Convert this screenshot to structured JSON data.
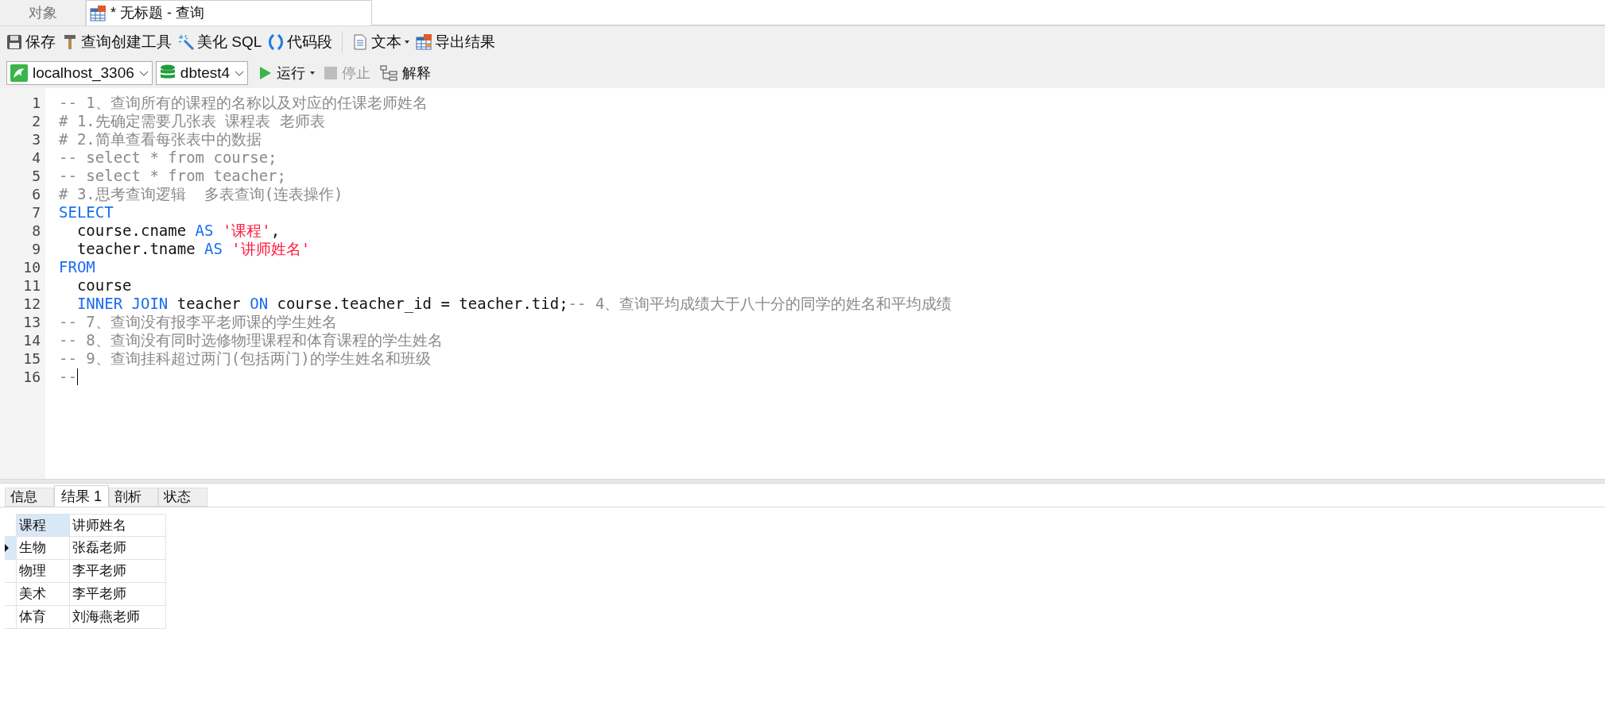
{
  "tabs": [
    {
      "label": "对象",
      "selected": false,
      "icon": false
    },
    {
      "label": "* 无标题 - 查询",
      "selected": true,
      "icon": true
    }
  ],
  "toolbar": [
    {
      "kind": "save",
      "label": "保存"
    },
    {
      "kind": "builder",
      "label": "查询创建工具"
    },
    {
      "kind": "beautify",
      "label": "美化 SQL"
    },
    {
      "kind": "snippet",
      "label": "代码段"
    },
    {
      "kind": "separator"
    },
    {
      "kind": "text",
      "label": "文本",
      "dropdown": true
    },
    {
      "kind": "export",
      "label": "导出结果"
    }
  ],
  "connection": {
    "value": "localhost_3306"
  },
  "database": {
    "value": "dbtest4"
  },
  "actions": [
    {
      "kind": "run",
      "label": "运行",
      "dropdown": true,
      "disabled": false
    },
    {
      "kind": "stop",
      "label": "停止",
      "disabled": true
    },
    {
      "kind": "explain",
      "label": "解释",
      "disabled": false
    }
  ],
  "editor": {
    "lines": [
      {
        "number": "1",
        "tokens": [
          {
            "kind": "comment",
            "text": "-- 1、查询所有的课程的名称以及对应的任课老师姓名"
          }
        ]
      },
      {
        "number": "2",
        "tokens": [
          {
            "kind": "comment",
            "text": "# 1.先确定需要几张表 课程表 老师表"
          }
        ]
      },
      {
        "number": "3",
        "tokens": [
          {
            "kind": "comment",
            "text": "# 2.简单查看每张表中的数据"
          }
        ]
      },
      {
        "number": "4",
        "tokens": [
          {
            "kind": "comment",
            "text": "-- select * from course;"
          }
        ]
      },
      {
        "number": "5",
        "tokens": [
          {
            "kind": "comment",
            "text": "-- select * from teacher;"
          }
        ]
      },
      {
        "number": "6",
        "tokens": [
          {
            "kind": "comment",
            "text": "# 3.思考查询逻辑  多表查询(连表操作)"
          }
        ]
      },
      {
        "number": "7",
        "tokens": [
          {
            "kind": "keyword",
            "text": "SELECT"
          }
        ]
      },
      {
        "number": "8",
        "indent": true,
        "tokens": [
          {
            "kind": "plain",
            "text": "course.cname "
          },
          {
            "kind": "keyword",
            "text": "AS "
          },
          {
            "kind": "string",
            "text": "'课程'"
          },
          {
            "kind": "plain",
            "text": ","
          }
        ]
      },
      {
        "number": "9",
        "indent": true,
        "tokens": [
          {
            "kind": "plain",
            "text": "teacher.tname "
          },
          {
            "kind": "keyword",
            "text": "AS "
          },
          {
            "kind": "string",
            "text": "'讲师姓名'"
          }
        ]
      },
      {
        "number": "10",
        "tokens": [
          {
            "kind": "keyword",
            "text": "FROM"
          }
        ]
      },
      {
        "number": "11",
        "indent": true,
        "tokens": [
          {
            "kind": "plain",
            "text": "course"
          }
        ]
      },
      {
        "number": "12",
        "indent": true,
        "tokens": [
          {
            "kind": "keyword",
            "text": "INNER JOIN"
          },
          {
            "kind": "plain",
            "text": " teacher "
          },
          {
            "kind": "keyword",
            "text": "ON"
          },
          {
            "kind": "plain",
            "text": " course.teacher_id = teacher.tid;"
          },
          {
            "kind": "comment",
            "text": "-- 4、查询平均成绩大于八十分的同学的姓名和平均成绩"
          }
        ]
      },
      {
        "number": "13",
        "tokens": [
          {
            "kind": "comment",
            "text": "-- 7、查询没有报李平老师课的学生姓名"
          }
        ]
      },
      {
        "number": "14",
        "tokens": [
          {
            "kind": "comment",
            "text": "-- 8、查询没有同时选修物理课程和体育课程的学生姓名"
          }
        ]
      },
      {
        "number": "15",
        "tokens": [
          {
            "kind": "comment",
            "text": "-- 9、查询挂科超过两门(包括两门)的学生姓名和班级"
          }
        ]
      },
      {
        "number": "16",
        "tokens": [
          {
            "kind": "comment",
            "text": "--"
          }
        ],
        "cursor": true
      }
    ]
  },
  "result_tabs": [
    {
      "label": "信息",
      "selected": false
    },
    {
      "label": "结果 1",
      "selected": true
    },
    {
      "label": "剖析",
      "selected": false
    },
    {
      "label": "状态",
      "selected": false
    }
  ],
  "result_table": {
    "columns": [
      {
        "label": "课程",
        "selected": true
      },
      {
        "label": "讲师姓名",
        "selected": false
      }
    ],
    "rows": [
      {
        "cells": [
          "生物",
          "张磊老师"
        ],
        "selected": true
      },
      {
        "cells": [
          "物理",
          "李平老师"
        ],
        "selected": false
      },
      {
        "cells": [
          "美术",
          "李平老师"
        ],
        "selected": false
      },
      {
        "cells": [
          "体育",
          "刘海燕老师"
        ],
        "selected": false
      }
    ]
  }
}
